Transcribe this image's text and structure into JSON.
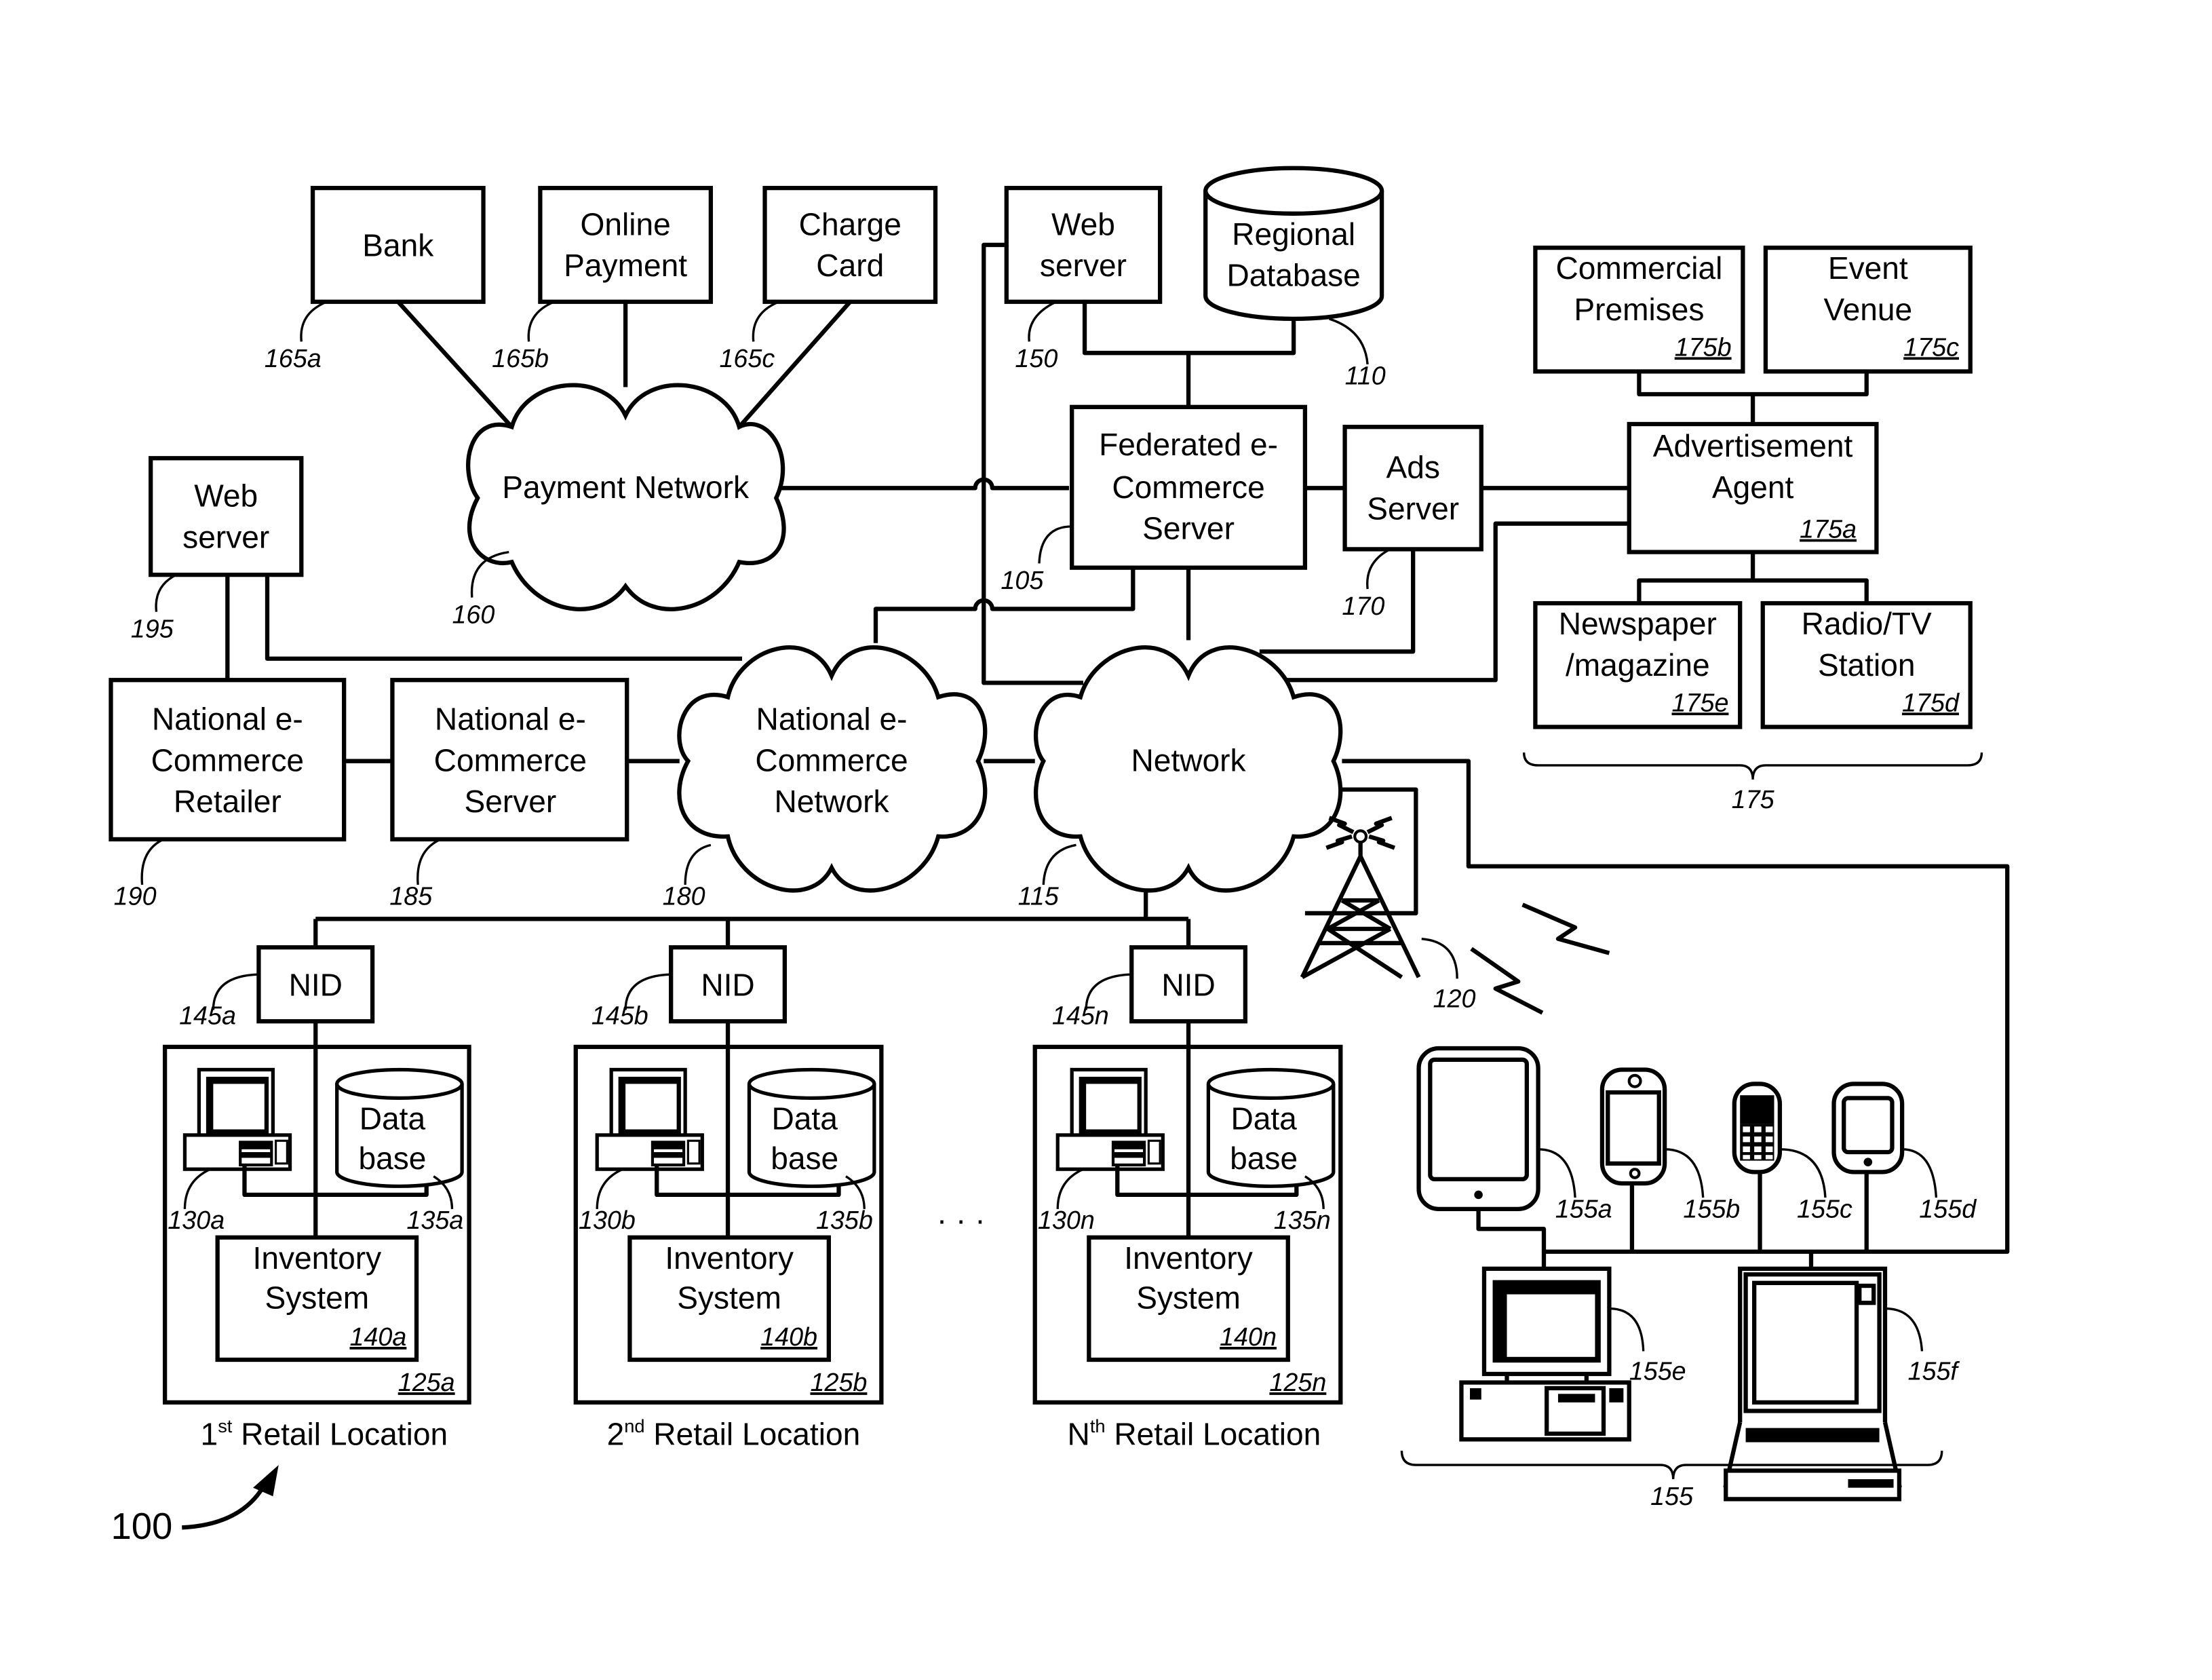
{
  "figure": {
    "number": "100",
    "nodes": {
      "bank": {
        "label": [
          "Bank"
        ],
        "ref": "165a"
      },
      "online_payment": {
        "label": [
          "Online",
          "Payment"
        ],
        "ref": "165b"
      },
      "charge_card": {
        "label": [
          "Charge",
          "Card"
        ],
        "ref": "165c"
      },
      "web_server_150": {
        "label": [
          "Web",
          "server"
        ],
        "ref": "150"
      },
      "regional_database": {
        "label": [
          "Regional",
          "Database"
        ],
        "ref": "110"
      },
      "commercial_premises": {
        "label": [
          "Commercial",
          "Premises"
        ],
        "ref": "175b"
      },
      "event_venue": {
        "label": [
          "Event",
          "Venue"
        ],
        "ref": "175c"
      },
      "payment_network": {
        "label": [
          "Payment Network"
        ],
        "ref": "160"
      },
      "federated_server": {
        "label": [
          "Federated e-",
          "Commerce",
          "Server"
        ],
        "ref": "105"
      },
      "ads_server": {
        "label": [
          "Ads",
          "Server"
        ],
        "ref": "170"
      },
      "advertisement_agent": {
        "label": [
          "Advertisement",
          "Agent"
        ],
        "ref": "175a"
      },
      "web_server_195": {
        "label": [
          "Web",
          "server"
        ],
        "ref": "195"
      },
      "newspaper": {
        "label": [
          "Newspaper",
          "/magazine"
        ],
        "ref": "175e"
      },
      "radio_tv": {
        "label": [
          "Radio/TV",
          "Station"
        ],
        "ref": "175d"
      },
      "advertiser_group": {
        "ref": "175"
      },
      "national_retailer": {
        "label": [
          "National e-",
          "Commerce",
          "Retailer"
        ],
        "ref": "190"
      },
      "national_server": {
        "label": [
          "National e-",
          "Commerce",
          "Server"
        ],
        "ref": "185"
      },
      "national_network": {
        "label": [
          "National e-",
          "Commerce",
          "Network"
        ],
        "ref": "180"
      },
      "network": {
        "label": [
          "Network"
        ],
        "ref": "115"
      },
      "cell_tower": {
        "ref": "120"
      },
      "ellipsis": "· · ·",
      "devices": {
        "tablet": {
          "ref": "155a"
        },
        "smartphone": {
          "ref": "155b"
        },
        "feature_phone": {
          "ref": "155c"
        },
        "pda": {
          "ref": "155d"
        },
        "desktop": {
          "ref": "155e"
        },
        "laptop": {
          "ref": "155f"
        },
        "group_ref": "155"
      }
    },
    "retail_locations": [
      {
        "nid_label": "NID",
        "nid_ref": "145a",
        "pc_ref": "130a",
        "db_label": [
          "Data",
          "base"
        ],
        "db_ref": "135a",
        "inv_label": [
          "Inventory",
          "System"
        ],
        "inv_ref": "140a",
        "loc_ref": "125a",
        "caption_num": "1",
        "caption_sup": "st",
        "caption_text": " Retail Location"
      },
      {
        "nid_label": "NID",
        "nid_ref": "145b",
        "pc_ref": "130b",
        "db_label": [
          "Data",
          "base"
        ],
        "db_ref": "135b",
        "inv_label": [
          "Inventory",
          "System"
        ],
        "inv_ref": "140b",
        "loc_ref": "125b",
        "caption_num": "2",
        "caption_sup": "nd",
        "caption_text": " Retail Location"
      },
      {
        "nid_label": "NID",
        "nid_ref": "145n",
        "pc_ref": "130n",
        "db_label": [
          "Data",
          "base"
        ],
        "db_ref": "135n",
        "inv_label": [
          "Inventory",
          "System"
        ],
        "inv_ref": "140n",
        "loc_ref": "125n",
        "caption_num": "N",
        "caption_sup": "th",
        "caption_text": " Retail Location"
      }
    ]
  }
}
